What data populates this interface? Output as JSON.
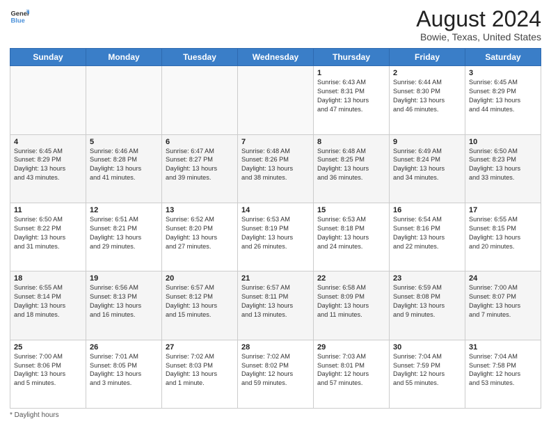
{
  "header": {
    "logo_line1": "General",
    "logo_line2": "Blue",
    "month_year": "August 2024",
    "location": "Bowie, Texas, United States"
  },
  "days_of_week": [
    "Sunday",
    "Monday",
    "Tuesday",
    "Wednesday",
    "Thursday",
    "Friday",
    "Saturday"
  ],
  "weeks": [
    [
      {
        "num": "",
        "info": ""
      },
      {
        "num": "",
        "info": ""
      },
      {
        "num": "",
        "info": ""
      },
      {
        "num": "",
        "info": ""
      },
      {
        "num": "1",
        "info": "Sunrise: 6:43 AM\nSunset: 8:31 PM\nDaylight: 13 hours\nand 47 minutes."
      },
      {
        "num": "2",
        "info": "Sunrise: 6:44 AM\nSunset: 8:30 PM\nDaylight: 13 hours\nand 46 minutes."
      },
      {
        "num": "3",
        "info": "Sunrise: 6:45 AM\nSunset: 8:29 PM\nDaylight: 13 hours\nand 44 minutes."
      }
    ],
    [
      {
        "num": "4",
        "info": "Sunrise: 6:45 AM\nSunset: 8:29 PM\nDaylight: 13 hours\nand 43 minutes."
      },
      {
        "num": "5",
        "info": "Sunrise: 6:46 AM\nSunset: 8:28 PM\nDaylight: 13 hours\nand 41 minutes."
      },
      {
        "num": "6",
        "info": "Sunrise: 6:47 AM\nSunset: 8:27 PM\nDaylight: 13 hours\nand 39 minutes."
      },
      {
        "num": "7",
        "info": "Sunrise: 6:48 AM\nSunset: 8:26 PM\nDaylight: 13 hours\nand 38 minutes."
      },
      {
        "num": "8",
        "info": "Sunrise: 6:48 AM\nSunset: 8:25 PM\nDaylight: 13 hours\nand 36 minutes."
      },
      {
        "num": "9",
        "info": "Sunrise: 6:49 AM\nSunset: 8:24 PM\nDaylight: 13 hours\nand 34 minutes."
      },
      {
        "num": "10",
        "info": "Sunrise: 6:50 AM\nSunset: 8:23 PM\nDaylight: 13 hours\nand 33 minutes."
      }
    ],
    [
      {
        "num": "11",
        "info": "Sunrise: 6:50 AM\nSunset: 8:22 PM\nDaylight: 13 hours\nand 31 minutes."
      },
      {
        "num": "12",
        "info": "Sunrise: 6:51 AM\nSunset: 8:21 PM\nDaylight: 13 hours\nand 29 minutes."
      },
      {
        "num": "13",
        "info": "Sunrise: 6:52 AM\nSunset: 8:20 PM\nDaylight: 13 hours\nand 27 minutes."
      },
      {
        "num": "14",
        "info": "Sunrise: 6:53 AM\nSunset: 8:19 PM\nDaylight: 13 hours\nand 26 minutes."
      },
      {
        "num": "15",
        "info": "Sunrise: 6:53 AM\nSunset: 8:18 PM\nDaylight: 13 hours\nand 24 minutes."
      },
      {
        "num": "16",
        "info": "Sunrise: 6:54 AM\nSunset: 8:16 PM\nDaylight: 13 hours\nand 22 minutes."
      },
      {
        "num": "17",
        "info": "Sunrise: 6:55 AM\nSunset: 8:15 PM\nDaylight: 13 hours\nand 20 minutes."
      }
    ],
    [
      {
        "num": "18",
        "info": "Sunrise: 6:55 AM\nSunset: 8:14 PM\nDaylight: 13 hours\nand 18 minutes."
      },
      {
        "num": "19",
        "info": "Sunrise: 6:56 AM\nSunset: 8:13 PM\nDaylight: 13 hours\nand 16 minutes."
      },
      {
        "num": "20",
        "info": "Sunrise: 6:57 AM\nSunset: 8:12 PM\nDaylight: 13 hours\nand 15 minutes."
      },
      {
        "num": "21",
        "info": "Sunrise: 6:57 AM\nSunset: 8:11 PM\nDaylight: 13 hours\nand 13 minutes."
      },
      {
        "num": "22",
        "info": "Sunrise: 6:58 AM\nSunset: 8:09 PM\nDaylight: 13 hours\nand 11 minutes."
      },
      {
        "num": "23",
        "info": "Sunrise: 6:59 AM\nSunset: 8:08 PM\nDaylight: 13 hours\nand 9 minutes."
      },
      {
        "num": "24",
        "info": "Sunrise: 7:00 AM\nSunset: 8:07 PM\nDaylight: 13 hours\nand 7 minutes."
      }
    ],
    [
      {
        "num": "25",
        "info": "Sunrise: 7:00 AM\nSunset: 8:06 PM\nDaylight: 13 hours\nand 5 minutes."
      },
      {
        "num": "26",
        "info": "Sunrise: 7:01 AM\nSunset: 8:05 PM\nDaylight: 13 hours\nand 3 minutes."
      },
      {
        "num": "27",
        "info": "Sunrise: 7:02 AM\nSunset: 8:03 PM\nDaylight: 13 hours\nand 1 minute."
      },
      {
        "num": "28",
        "info": "Sunrise: 7:02 AM\nSunset: 8:02 PM\nDaylight: 12 hours\nand 59 minutes."
      },
      {
        "num": "29",
        "info": "Sunrise: 7:03 AM\nSunset: 8:01 PM\nDaylight: 12 hours\nand 57 minutes."
      },
      {
        "num": "30",
        "info": "Sunrise: 7:04 AM\nSunset: 7:59 PM\nDaylight: 12 hours\nand 55 minutes."
      },
      {
        "num": "31",
        "info": "Sunrise: 7:04 AM\nSunset: 7:58 PM\nDaylight: 12 hours\nand 53 minutes."
      }
    ]
  ],
  "footer": {
    "note": "Daylight hours"
  }
}
